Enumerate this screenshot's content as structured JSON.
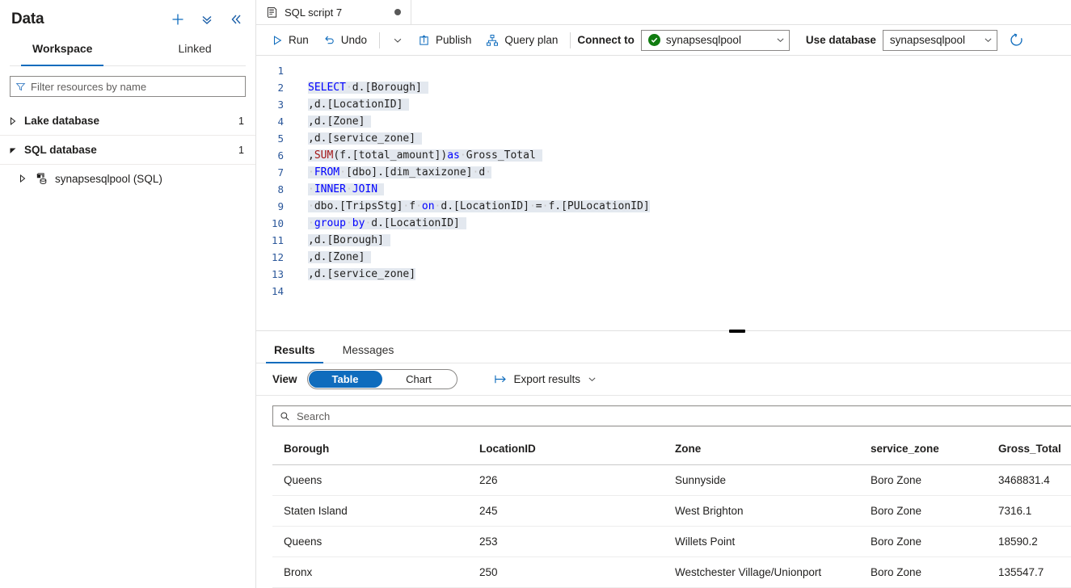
{
  "left": {
    "title": "Data",
    "actions": [
      {
        "name": "add-new-resource-button",
        "icon": "plus-icon"
      },
      {
        "name": "actions-menu-button",
        "icon": "double-chevron-down-icon"
      },
      {
        "name": "collapse-panel-button",
        "icon": "double-chevron-left-icon"
      }
    ],
    "tabs": [
      {
        "label": "Workspace",
        "active": true
      },
      {
        "label": "Linked",
        "active": false
      }
    ],
    "filter": {
      "placeholder": "Filter resources by name",
      "value": ""
    },
    "tree": [
      {
        "label": "Lake database",
        "count": "1",
        "expanded": false,
        "level": 0
      },
      {
        "label": "SQL database",
        "count": "1",
        "expanded": true,
        "level": 0
      },
      {
        "label": "synapsesqlpool (SQL)",
        "count": "",
        "expanded": false,
        "level": 1
      }
    ]
  },
  "doc_tab": {
    "name": "SQL script 7",
    "icon": "sql-script-icon",
    "dirty": true
  },
  "toolbar": {
    "run_label": "Run",
    "undo_label": "Undo",
    "more_icon": "chevron-down-icon",
    "publish_label": "Publish",
    "query_plan_label": "Query plan",
    "connect_to_label": "Connect to",
    "connect_to_value": "synapsesqlpool",
    "use_database_label": "Use database",
    "use_database_value": "synapsesqlpool",
    "refresh_icon": "refresh-icon"
  },
  "editor": {
    "lines": [
      {
        "n": "1",
        "segs": []
      },
      {
        "n": "2",
        "segs": [
          {
            "t": "SELECT",
            "c": "kw"
          },
          {
            "t": "·",
            "c": "dot-ws"
          },
          {
            "t": "d.[Borough]",
            "c": "pl"
          },
          {
            "t": " ",
            "c": "pl"
          }
        ]
      },
      {
        "n": "3",
        "segs": [
          {
            "t": ",d.[LocationID]",
            "c": "pl"
          },
          {
            "t": " ",
            "c": "pl"
          }
        ]
      },
      {
        "n": "4",
        "segs": [
          {
            "t": ",d.[Zone]",
            "c": "pl"
          },
          {
            "t": " ",
            "c": "pl"
          }
        ]
      },
      {
        "n": "5",
        "segs": [
          {
            "t": ",d.[service_zone]",
            "c": "pl"
          },
          {
            "t": " ",
            "c": "pl"
          }
        ]
      },
      {
        "n": "6",
        "segs": [
          {
            "t": ",",
            "c": "pl"
          },
          {
            "t": "SUM",
            "c": "fn"
          },
          {
            "t": "(f.[total_amount])",
            "c": "pl"
          },
          {
            "t": "as",
            "c": "kw"
          },
          {
            "t": "·",
            "c": "dot-ws"
          },
          {
            "t": "Gross_Total",
            "c": "pl"
          },
          {
            "t": " ",
            "c": "pl"
          }
        ]
      },
      {
        "n": "7",
        "segs": [
          {
            "t": "·",
            "c": "dot-ws"
          },
          {
            "t": "FROM",
            "c": "kw"
          },
          {
            "t": "·",
            "c": "dot-ws"
          },
          {
            "t": "[dbo].[dim_taxizone]",
            "c": "pl"
          },
          {
            "t": "·",
            "c": "dot-ws"
          },
          {
            "t": "d",
            "c": "pl"
          },
          {
            "t": "·",
            "c": "dot-ws"
          }
        ]
      },
      {
        "n": "8",
        "segs": [
          {
            "t": "·",
            "c": "dot-ws"
          },
          {
            "t": "INNER",
            "c": "kw"
          },
          {
            "t": "·",
            "c": "dot-ws"
          },
          {
            "t": "JOIN",
            "c": "kw"
          },
          {
            "t": " ",
            "c": "pl"
          }
        ]
      },
      {
        "n": "9",
        "segs": [
          {
            "t": "·",
            "c": "dot-ws"
          },
          {
            "t": "dbo.[TripsStg]",
            "c": "pl"
          },
          {
            "t": "·",
            "c": "dot-ws"
          },
          {
            "t": "f",
            "c": "pl"
          },
          {
            "t": "·",
            "c": "dot-ws"
          },
          {
            "t": "on",
            "c": "kw"
          },
          {
            "t": "·",
            "c": "dot-ws"
          },
          {
            "t": "d.[LocationID]",
            "c": "pl"
          },
          {
            "t": "·",
            "c": "dot-ws"
          },
          {
            "t": "=",
            "c": "pl"
          },
          {
            "t": "·",
            "c": "dot-ws"
          },
          {
            "t": "f.[PULocationID]",
            "c": "pl"
          }
        ]
      },
      {
        "n": "10",
        "segs": [
          {
            "t": "·",
            "c": "dot-ws"
          },
          {
            "t": "group",
            "c": "kw"
          },
          {
            "t": "·",
            "c": "dot-ws"
          },
          {
            "t": "by",
            "c": "kw"
          },
          {
            "t": "·",
            "c": "dot-ws"
          },
          {
            "t": "d.[LocationID]",
            "c": "pl"
          },
          {
            "t": " ",
            "c": "pl"
          }
        ]
      },
      {
        "n": "11",
        "segs": [
          {
            "t": ",d.[Borough]",
            "c": "pl"
          },
          {
            "t": " ",
            "c": "pl"
          }
        ]
      },
      {
        "n": "12",
        "segs": [
          {
            "t": ",d.[Zone]",
            "c": "pl"
          },
          {
            "t": " ",
            "c": "pl"
          }
        ]
      },
      {
        "n": "13",
        "segs": [
          {
            "t": ",d.[service_zone]",
            "c": "pl"
          }
        ]
      },
      {
        "n": "14",
        "segs": []
      }
    ]
  },
  "results": {
    "tabs": [
      {
        "label": "Results",
        "active": true
      },
      {
        "label": "Messages",
        "active": false
      }
    ],
    "view_label": "View",
    "view_options": [
      {
        "label": "Table",
        "selected": true
      },
      {
        "label": "Chart",
        "selected": false
      }
    ],
    "export_label": "Export results",
    "search": {
      "placeholder": "Search",
      "value": ""
    },
    "columns": [
      "Borough",
      "LocationID",
      "Zone",
      "service_zone",
      "Gross_Total"
    ],
    "rows": [
      [
        "Queens",
        "226",
        "Sunnyside",
        "Boro Zone",
        "3468831.4"
      ],
      [
        "Staten Island",
        "245",
        "West Brighton",
        "Boro Zone",
        "7316.1"
      ],
      [
        "Queens",
        "253",
        "Willets Point",
        "Boro Zone",
        "18590.2"
      ],
      [
        "Bronx",
        "250",
        "Westchester Village/Unionport",
        "Boro Zone",
        "135547.7"
      ]
    ]
  },
  "colors": {
    "accent": "#0f6cbd",
    "success": "#107c10",
    "keyword": "#0000ff",
    "function": "#a31515",
    "selection": "#e3e8ef"
  }
}
